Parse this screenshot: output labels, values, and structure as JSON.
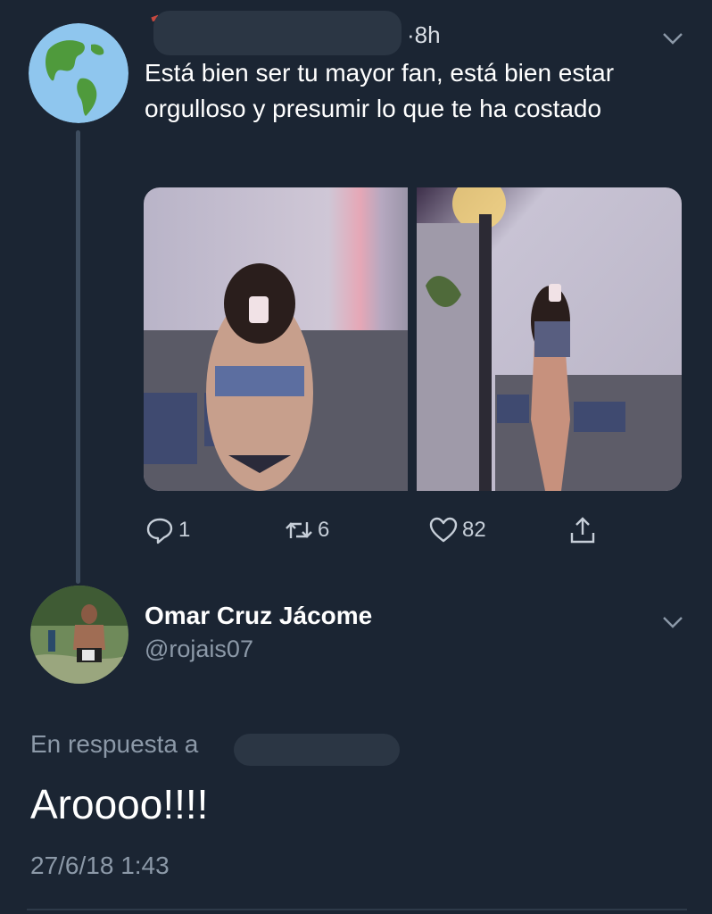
{
  "tweet": {
    "time": "·8h",
    "text": "Está bien ser tu mayor fan, está bien estar orgulloso y presumir lo que te ha costado",
    "avatar_icon": "globe-americas-icon",
    "actions": {
      "replies": "1",
      "retweets": "6",
      "likes": "82"
    }
  },
  "reply": {
    "name": "Omar Cruz Jácome",
    "handle": "@rojais07",
    "in_reply_to": "En respuesta a",
    "body": "Aroooo!!!!",
    "timestamp": "27/6/18 1:43"
  },
  "colors": {
    "background": "#1b2533",
    "secondary_text": "#8c99a8",
    "icon": "#c6ced8"
  }
}
